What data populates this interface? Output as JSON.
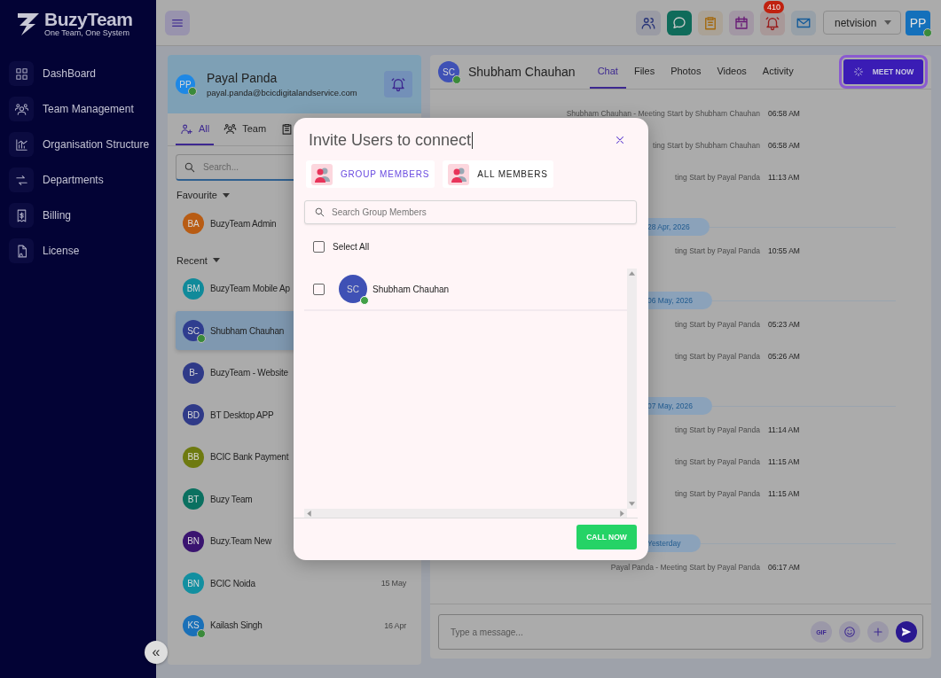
{
  "sidebar": {
    "logo": {
      "name": "BuzyTeam",
      "tagline": "One Team, One System"
    },
    "items": [
      {
        "label": "DashBoard",
        "kind": "grid"
      },
      {
        "label": "Team Management",
        "kind": "team"
      },
      {
        "label": "Organisation Structure",
        "kind": "chart"
      },
      {
        "label": "Departments",
        "kind": "swap"
      },
      {
        "label": "Billing",
        "kind": "receipt"
      },
      {
        "label": "License",
        "kind": "document"
      }
    ],
    "collapse_button": "«"
  },
  "topbar": {
    "apps": [
      {
        "kind": "people",
        "selected": false
      },
      {
        "kind": "chat",
        "selected": true
      },
      {
        "kind": "clipboard",
        "selected": false
      },
      {
        "kind": "calendar",
        "selected": false
      },
      {
        "kind": "bell",
        "selected": false,
        "badge": "410"
      },
      {
        "kind": "mail",
        "selected": false
      }
    ],
    "workspace": "netvision",
    "avatar": {
      "initials": "PP",
      "online": true
    }
  },
  "profile": {
    "initials": "PP",
    "online": true,
    "name": "Payal Panda",
    "email": "payal.panda@bcicdigitalandservice.com"
  },
  "contact_tabs": [
    {
      "kind": "add-person",
      "label": "All",
      "selected": true
    },
    {
      "kind": "team",
      "label": "Team",
      "selected": false
    },
    {
      "kind": "clipboard"
    }
  ],
  "contact_search": {
    "placeholder": "Search..."
  },
  "groups": [
    {
      "title": "Favourite",
      "expanded": true,
      "contacts": [
        {
          "initials": "BA",
          "name": "BuzyTeam Admin",
          "color": "#b85c14",
          "online": false,
          "selected": false
        }
      ]
    },
    {
      "title": "Recent",
      "expanded": true,
      "contacts": [
        {
          "initials": "BM",
          "name": "BuzyTeam Mobile Ap",
          "color": "#108a9a",
          "online": false,
          "selected": false
        },
        {
          "initials": "SC",
          "name": "Shubham Chauhan",
          "color": "#2f3d8f",
          "online": true,
          "selected": true
        },
        {
          "initials": "B-",
          "name": "BuzyTeam - Website",
          "color": "#2f3a88",
          "online": false,
          "selected": false
        },
        {
          "initials": "BD",
          "name": "BT Desktop APP",
          "color": "#2f3a88",
          "online": false,
          "selected": false
        },
        {
          "initials": "BB",
          "name": "BCIC Bank Payment",
          "color": "#6e7a10",
          "online": false,
          "selected": false
        },
        {
          "initials": "BT",
          "name": "Buzy Team",
          "color": "#0a7060",
          "online": false,
          "selected": false
        },
        {
          "initials": "BN",
          "name": "Buzy.Team New",
          "color": "#3a1470",
          "online": false,
          "selected": false
        },
        {
          "initials": "BN",
          "name": "BCIC Noida",
          "color": "#128fa0",
          "online": false,
          "selected": false,
          "date": "15 May"
        },
        {
          "initials": "KS",
          "name": "Kailash Singh",
          "color": "#1a70b8",
          "online": true,
          "selected": false,
          "date": "16 Apr"
        }
      ]
    }
  ],
  "chat": {
    "contact": {
      "initials": "SC",
      "online": true,
      "name": "Shubham Chauhan"
    },
    "tabs": [
      {
        "label": "Chat",
        "selected": true
      },
      {
        "label": "Files",
        "selected": false
      },
      {
        "label": "Photos",
        "selected": false
      },
      {
        "label": "Videos",
        "selected": false
      },
      {
        "label": "Activity",
        "selected": false
      }
    ],
    "meet_button": "MEET NOW",
    "messages": [
      {
        "kind": "event",
        "text": "Shubham Chauhan - Meeting Start by Shubham Chauhan",
        "time": "06:58 AM"
      },
      {
        "kind": "event",
        "text": "ting Start by Shubham Chauhan",
        "time": "06:58 AM"
      },
      {
        "kind": "event",
        "text": "ting Start by Payal Panda",
        "time": "11:13 AM"
      },
      {
        "kind": "date",
        "text": "28 Apr, 2026"
      },
      {
        "kind": "event",
        "text": "ting Start by Payal Panda",
        "time": "10:55 AM"
      },
      {
        "kind": "date",
        "text": "06 May, 2026"
      },
      {
        "kind": "event",
        "text": "ting Start by Payal Panda",
        "time": "05:23 AM"
      },
      {
        "kind": "event",
        "text": "ting Start by Payal Panda",
        "time": "05:26 AM"
      },
      {
        "kind": "date",
        "text": "07 May, 2026"
      },
      {
        "kind": "event",
        "text": "ting Start by Payal Panda",
        "time": "11:14 AM"
      },
      {
        "kind": "event",
        "text": "ting Start by Payal Panda",
        "time": "11:15 AM"
      },
      {
        "kind": "event",
        "text": "ting Start by Payal Panda",
        "time": "11:15 AM"
      },
      {
        "kind": "date",
        "text": "Yesterday"
      },
      {
        "kind": "event",
        "text": "Payal Panda - Meeting Start by Payal Panda",
        "time": "06:17 AM"
      }
    ],
    "composer": {
      "placeholder": "Type a message...",
      "gif_button": "GIF"
    }
  },
  "dialog": {
    "title": "Invite Users to connect",
    "tabs": [
      {
        "label": "GROUP MEMBERS",
        "selected": true
      },
      {
        "label": "ALL MEMBERS",
        "selected": false
      }
    ],
    "search": {
      "placeholder": "Search Group Members"
    },
    "select_all": {
      "label": "Select All",
      "checked": false
    },
    "members": [
      {
        "initials": "SC",
        "name": "Shubham Chauhan",
        "online": true,
        "checked": false
      }
    ],
    "call_button": "CALL NOW"
  }
}
